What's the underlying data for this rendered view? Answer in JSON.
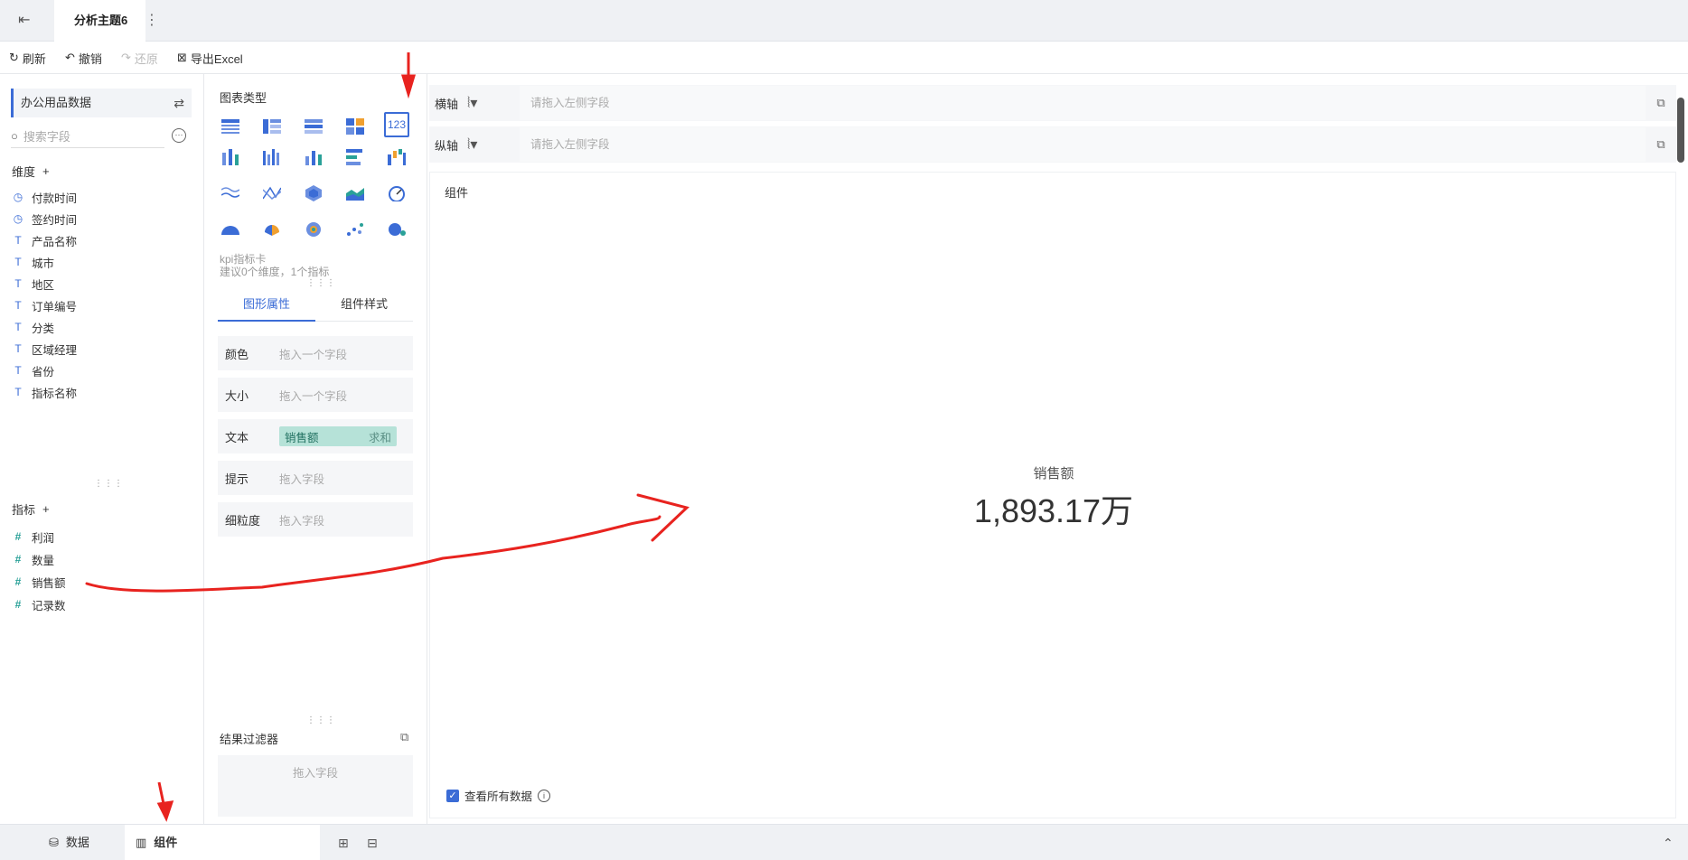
{
  "topbar": {
    "tab_title": "分析主题6"
  },
  "toolbar": {
    "refresh": "刷新",
    "undo": "撤销",
    "redo": "还原",
    "export": "导出Excel"
  },
  "left": {
    "datasource": "办公用品数据",
    "search_placeholder": "搜索字段",
    "dimension_title": "维度",
    "dimensions": [
      {
        "icon": "clock-icon",
        "label": "付款时间"
      },
      {
        "icon": "clock-icon",
        "label": "签约时间"
      },
      {
        "icon": "text-type-icon",
        "label": "产品名称"
      },
      {
        "icon": "text-type-icon",
        "label": "城市"
      },
      {
        "icon": "text-type-icon",
        "label": "地区"
      },
      {
        "icon": "text-type-icon",
        "label": "订单编号"
      },
      {
        "icon": "text-type-icon",
        "label": "分类"
      },
      {
        "icon": "text-type-icon",
        "label": "区域经理"
      },
      {
        "icon": "text-type-icon",
        "label": "省份"
      },
      {
        "icon": "text-type-icon",
        "label": "指标名称"
      }
    ],
    "measure_title": "指标",
    "measures": [
      {
        "icon": "hash-icon",
        "label": "利润"
      },
      {
        "icon": "hash-icon",
        "label": "数量"
      },
      {
        "icon": "hash-icon",
        "label": "销售额"
      },
      {
        "icon": "hash-icon",
        "label": "记录数"
      }
    ]
  },
  "mid": {
    "chart_type_title": "图表类型",
    "selected_chart_name": "kpi指标卡",
    "selected_chart_hint": "建议0个维度，1个指标",
    "selected_chart_icon": "123",
    "tabs": [
      "图形属性",
      "组件样式"
    ],
    "props": [
      {
        "label": "颜色",
        "value": "拖入一个字段"
      },
      {
        "label": "大小",
        "value": "拖入一个字段"
      },
      {
        "label": "文本",
        "field": "销售额",
        "agg": "求和"
      },
      {
        "label": "提示",
        "value": "拖入字段"
      },
      {
        "label": "细粒度",
        "value": "拖入字段"
      }
    ],
    "filter_title": "结果过滤器",
    "filter_placeholder": "拖入字段"
  },
  "main": {
    "x_axis_label": "横轴",
    "y_axis_label": "纵轴",
    "axis_placeholder": "请拖入左侧字段",
    "canvas_title": "组件",
    "kpi_label": "销售额",
    "kpi_value": "1,893.17万",
    "view_all": "查看所有数据"
  },
  "bottom": {
    "data_tab": "数据",
    "component_tab": "组件"
  },
  "colors": {
    "accent": "#3b6cd6",
    "measure": "#2aa198",
    "annotation": "#e8231f"
  }
}
